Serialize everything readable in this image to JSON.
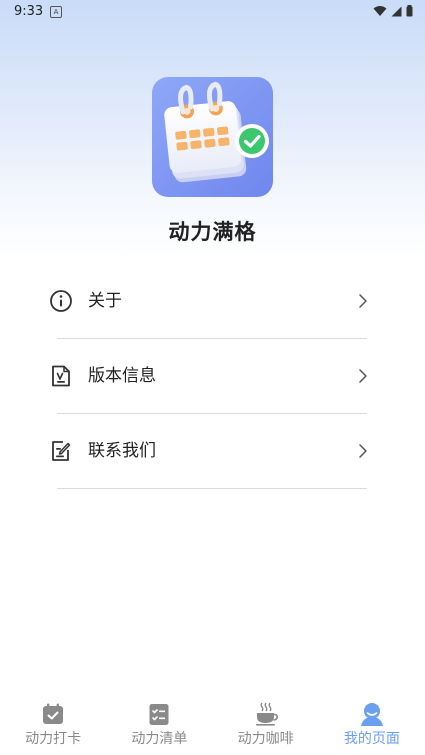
{
  "status_bar": {
    "time": "9:33",
    "notification_glyph": "A"
  },
  "app": {
    "name": "动力满格"
  },
  "menu": {
    "items": [
      {
        "label": "关于",
        "icon": "info-icon"
      },
      {
        "label": "版本信息",
        "icon": "document-version-icon"
      },
      {
        "label": "联系我们",
        "icon": "edit-note-icon"
      }
    ]
  },
  "bottom_nav": {
    "active_color": "#6aa0f0",
    "inactive_color": "#8a8a8a",
    "items": [
      {
        "label": "动力打卡",
        "icon": "calendar-check-icon",
        "active": false
      },
      {
        "label": "动力清单",
        "icon": "checklist-icon",
        "active": false
      },
      {
        "label": "动力咖啡",
        "icon": "coffee-cup-icon",
        "active": false
      },
      {
        "label": "我的页面",
        "icon": "user-icon",
        "active": true
      }
    ]
  }
}
